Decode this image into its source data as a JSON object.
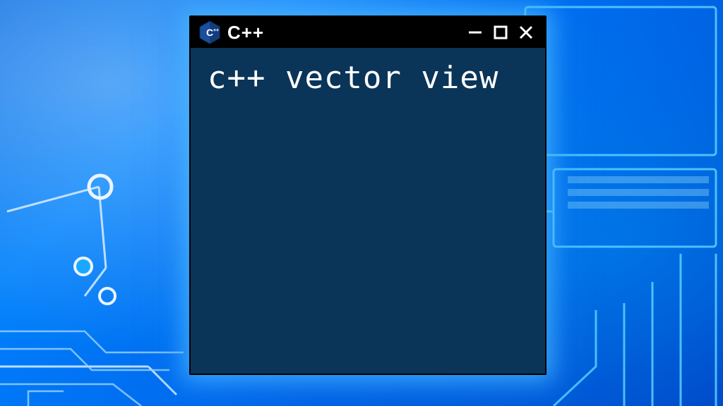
{
  "window": {
    "title": "C++",
    "content": "c++ vector view",
    "icon_name": "cpp-hex-icon",
    "colors": {
      "titlebar_bg": "#000000",
      "body_bg": "#0a3558",
      "text": "#ffffff"
    }
  }
}
